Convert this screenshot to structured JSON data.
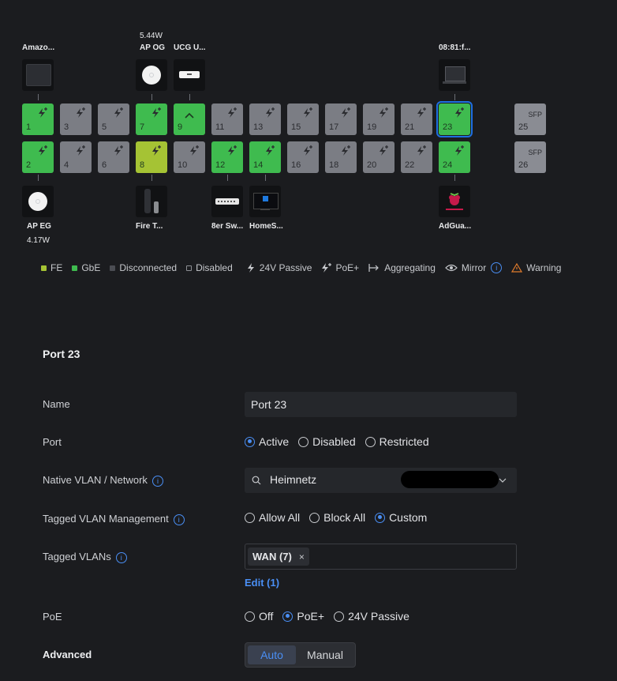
{
  "devices_top": [
    {
      "label": "Amazo...",
      "icon": "amazon-device-icon"
    },
    {
      "label": "AP OG",
      "power": "5.44W",
      "icon": "access-point-icon"
    },
    {
      "label": "UCG U...",
      "icon": "gateway-icon"
    },
    {
      "label": "08:81:f...",
      "icon": "monitor-icon"
    }
  ],
  "devices_bottom": [
    {
      "label": "AP EG",
      "power": "4.17W",
      "icon": "access-point-icon"
    },
    {
      "label": "Fire T...",
      "icon": "fire-tv-icon"
    },
    {
      "label": "8er Sw...",
      "icon": "switch-icon"
    },
    {
      "label": "HomeS...",
      "icon": "windows-server-icon"
    },
    {
      "label": "AdGua...",
      "icon": "raspberry-pi-icon"
    }
  ],
  "ports_top": [
    {
      "num": "1",
      "state": "gbe",
      "icon": "bolt-plus-icon"
    },
    {
      "num": "3",
      "state": "off",
      "icon": "bolt-plus-icon"
    },
    {
      "num": "5",
      "state": "off",
      "icon": "bolt-plus-icon"
    },
    {
      "num": "7",
      "state": "gbe",
      "icon": "bolt-plus-icon"
    },
    {
      "num": "9",
      "state": "gbe",
      "icon": "uplink-icon"
    },
    {
      "num": "11",
      "state": "off",
      "icon": "bolt-plus-icon"
    },
    {
      "num": "13",
      "state": "off",
      "icon": "bolt-plus-icon"
    },
    {
      "num": "15",
      "state": "off",
      "icon": "bolt-plus-icon"
    },
    {
      "num": "17",
      "state": "off",
      "icon": "bolt-plus-icon"
    },
    {
      "num": "19",
      "state": "off",
      "icon": "bolt-plus-icon"
    },
    {
      "num": "21",
      "state": "off",
      "icon": "bolt-plus-icon"
    },
    {
      "num": "23",
      "state": "gbe",
      "icon": "bolt-plus-icon",
      "selected": true
    }
  ],
  "ports_bottom": [
    {
      "num": "2",
      "state": "gbe",
      "icon": "bolt-plus-icon"
    },
    {
      "num": "4",
      "state": "off",
      "icon": "bolt-plus-icon"
    },
    {
      "num": "6",
      "state": "off",
      "icon": "bolt-plus-icon"
    },
    {
      "num": "8",
      "state": "fe",
      "icon": "bolt-plus-icon"
    },
    {
      "num": "10",
      "state": "off",
      "icon": "bolt-plus-icon"
    },
    {
      "num": "12",
      "state": "gbe",
      "icon": "bolt-plus-icon"
    },
    {
      "num": "14",
      "state": "gbe",
      "icon": "bolt-plus-icon"
    },
    {
      "num": "16",
      "state": "off",
      "icon": "bolt-plus-icon"
    },
    {
      "num": "18",
      "state": "off",
      "icon": "bolt-plus-icon"
    },
    {
      "num": "20",
      "state": "off",
      "icon": "bolt-plus-icon"
    },
    {
      "num": "22",
      "state": "off",
      "icon": "bolt-plus-icon"
    },
    {
      "num": "24",
      "state": "gbe",
      "icon": "bolt-plus-icon"
    }
  ],
  "sfp_ports": [
    {
      "num": "25",
      "tag": "SFP"
    },
    {
      "num": "26",
      "tag": "SFP"
    }
  ],
  "legend": {
    "fe": "FE",
    "gbe": "GbE",
    "disconnected": "Disconnected",
    "disabled": "Disabled",
    "passive": "24V Passive",
    "poe": "PoE+",
    "aggregating": "Aggregating",
    "mirror": "Mirror",
    "warning": "Warning"
  },
  "colors": {
    "gbe": "#3fbb4f",
    "fe": "#a5c334",
    "disconnected": "#7b7d84",
    "accent": "#4a8ff5",
    "warning": "#e07b2c"
  },
  "form": {
    "title": "Port 23",
    "name_label": "Name",
    "name_value": "Port 23",
    "port_label": "Port",
    "port_options": [
      "Active",
      "Disabled",
      "Restricted"
    ],
    "port_selected": "Active",
    "native_label": "Native VLAN / Network",
    "native_value": "Heimnetz",
    "tagged_mgmt_label": "Tagged VLAN Management",
    "tagged_mgmt_options": [
      "Allow All",
      "Block All",
      "Custom"
    ],
    "tagged_mgmt_selected": "Custom",
    "tagged_label": "Tagged VLANs",
    "tagged_chip": "WAN (7)",
    "edit_link": "Edit (1)",
    "poe_label": "PoE",
    "poe_options": [
      "Off",
      "PoE+",
      "24V Passive"
    ],
    "poe_selected": "PoE+",
    "advanced_label": "Advanced",
    "advanced_options": [
      "Auto",
      "Manual"
    ],
    "advanced_selected": "Auto"
  }
}
